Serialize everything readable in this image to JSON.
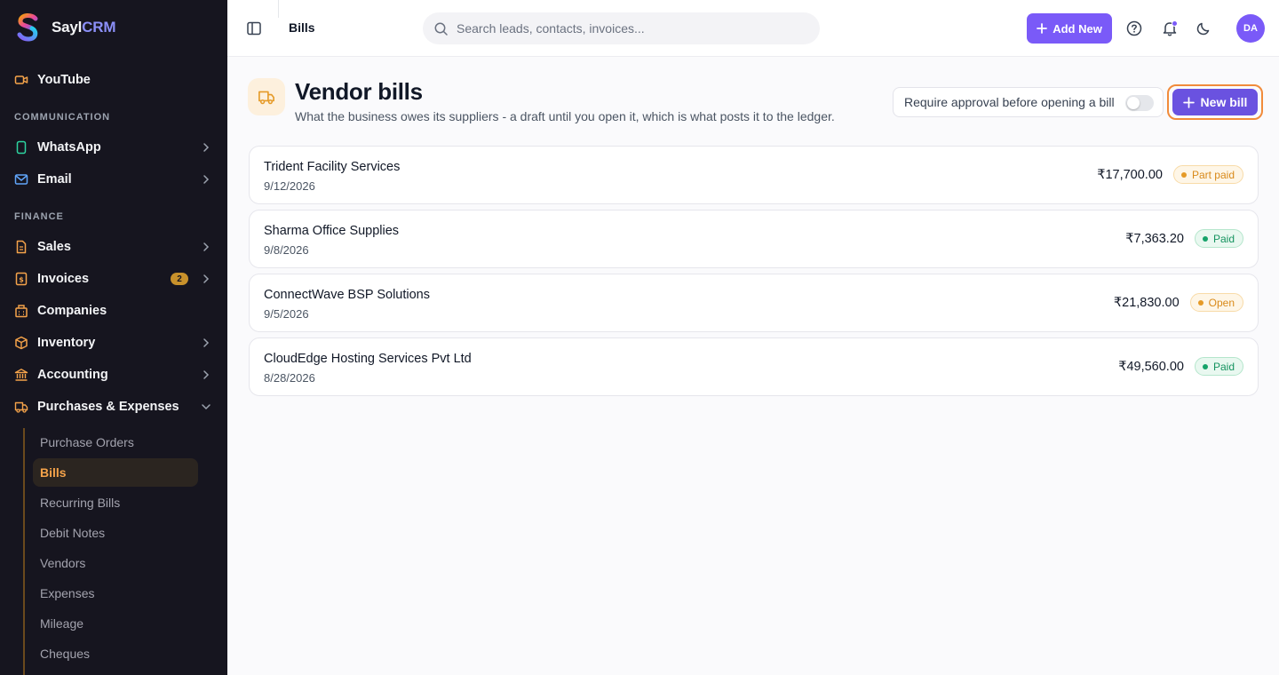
{
  "brand": {
    "name_main": "Sayl",
    "name_accent": "CRM"
  },
  "sidebar": {
    "youtube": "YouTube",
    "section_communication": "COMMUNICATION",
    "whatsapp": "WhatsApp",
    "email": "Email",
    "section_finance": "FINANCE",
    "sales": "Sales",
    "invoices": "Invoices",
    "invoices_badge": "2",
    "companies": "Companies",
    "inventory": "Inventory",
    "accounting": "Accounting",
    "purchases": "Purchases & Expenses",
    "sub_items": [
      "Purchase Orders",
      "Bills",
      "Recurring Bills",
      "Debit Notes",
      "Vendors",
      "Expenses",
      "Mileage",
      "Cheques"
    ]
  },
  "header": {
    "breadcrumb": "Bills",
    "search_placeholder": "Search leads, contacts, invoices...",
    "add_new": "Add New",
    "avatar_initials": "DA"
  },
  "page": {
    "title": "Vendor bills",
    "subtitle": "What the business owes its suppliers - a draft until you open it, which is what posts it to the ledger.",
    "approval_label": "Require approval before opening a bill",
    "approval_enabled": false,
    "new_bill": "New bill"
  },
  "bills": [
    {
      "name": "Trident Facility Services",
      "date": "9/12/2026",
      "amount": "₹17,700.00",
      "status": "Part paid"
    },
    {
      "name": "Sharma Office Supplies",
      "date": "9/8/2026",
      "amount": "₹7,363.20",
      "status": "Paid"
    },
    {
      "name": "ConnectWave BSP Solutions",
      "date": "9/5/2026",
      "amount": "₹21,830.00",
      "status": "Open"
    },
    {
      "name": "CloudEdge Hosting Services Pvt Ltd",
      "date": "8/28/2026",
      "amount": "₹49,560.00",
      "status": "Paid"
    }
  ],
  "colors": {
    "accent": "#7a5af8",
    "sidebar_bg": "#16151f",
    "active_nav": "#f5a34a",
    "status_paid": "#16a36a",
    "status_pending": "#e59a27"
  }
}
